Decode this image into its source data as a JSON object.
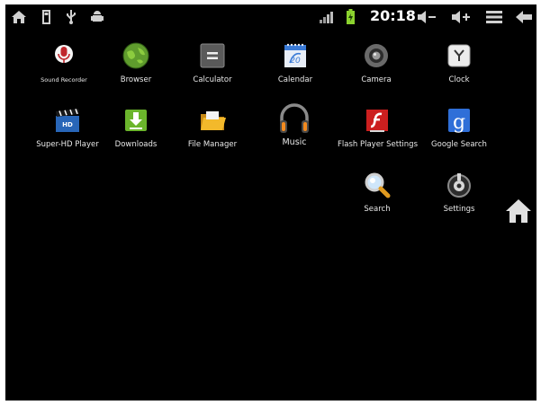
{
  "statusbar": {
    "left_icons": [
      "home-icon",
      "sd-card-icon",
      "usb-icon",
      "android-debug-icon"
    ],
    "right_icons": [
      "signal-icon",
      "battery-icon",
      "volume-down-icon",
      "volume-up-icon",
      "menu-icon",
      "back-icon"
    ],
    "time": "20:18",
    "battery_color": "#8bd22e"
  },
  "apps": [
    {
      "id": "sound-recorder",
      "label": "Sound Recorder",
      "icon": "microphone-icon"
    },
    {
      "id": "browser",
      "label": "Browser",
      "icon": "globe-icon"
    },
    {
      "id": "calculator",
      "label": "Calculator",
      "icon": "calculator-icon"
    },
    {
      "id": "calendar",
      "label": "Calendar",
      "icon": "calendar-icon"
    },
    {
      "id": "camera",
      "label": "Camera",
      "icon": "camera-icon"
    },
    {
      "id": "clock",
      "label": "Clock",
      "icon": "clock-icon"
    },
    {
      "id": "super-hd-player",
      "label": "Super-HD Player",
      "icon": "clapperboard-icon"
    },
    {
      "id": "downloads",
      "label": "Downloads",
      "icon": "download-icon"
    },
    {
      "id": "file-manager",
      "label": "File Manager",
      "icon": "folder-icon"
    },
    {
      "id": "music",
      "label": "Music",
      "icon": "headphones-icon"
    },
    {
      "id": "flash-player-settings",
      "label": "Flash Player Settings",
      "icon": "flash-icon"
    },
    {
      "id": "google-search",
      "label": "Google Search",
      "icon": "google-icon"
    },
    {
      "id": "search",
      "label": "Search",
      "icon": "magnifier-icon"
    },
    {
      "id": "settings",
      "label": "Settings",
      "icon": "settings-icon"
    }
  ],
  "sidebar": {
    "home_icon": "home-icon"
  }
}
